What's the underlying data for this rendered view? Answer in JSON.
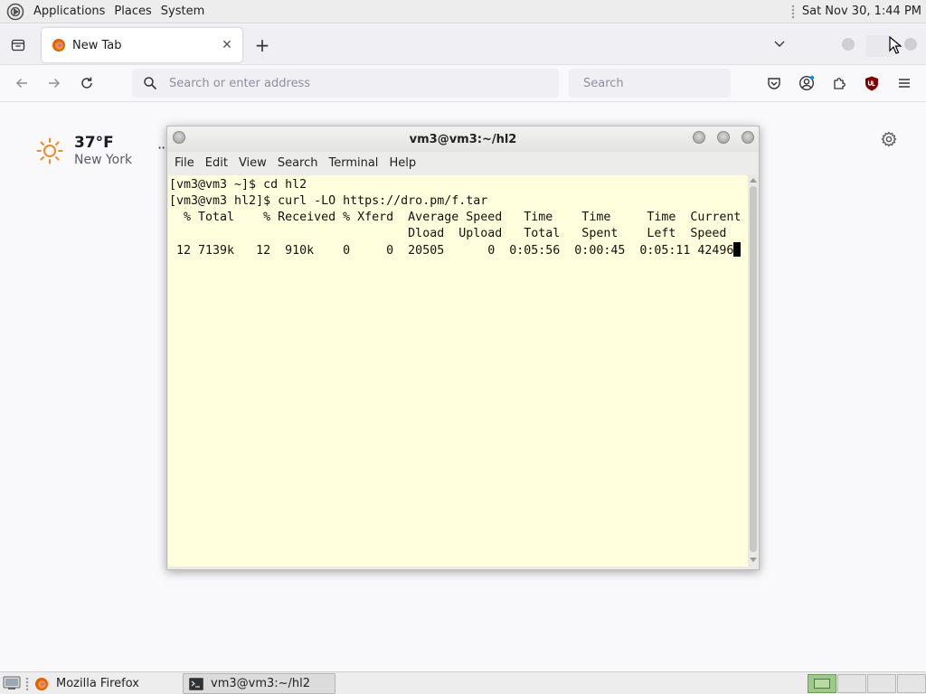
{
  "top_panel": {
    "menus": [
      "Applications",
      "Places",
      "System"
    ],
    "clock": "Sat Nov 30, 1:44 PM"
  },
  "browser": {
    "tab": {
      "title": "New Tab",
      "close_label": "✕"
    },
    "new_tab_label": "+",
    "url_placeholder": "Search or enter address",
    "search_placeholder": "Search"
  },
  "newtab": {
    "weather": {
      "temp": "37°F",
      "city": "New York",
      "more_label": "··"
    }
  },
  "terminal": {
    "title": "vm3@vm3:~/hl2",
    "menus": [
      "File",
      "Edit",
      "View",
      "Search",
      "Terminal",
      "Help"
    ],
    "lines": [
      "[vm3@vm3 ~]$ cd hl2",
      "[vm3@vm3 hl2]$ curl -LO https://dro.pm/f.tar",
      "  % Total    % Received % Xferd  Average Speed   Time    Time     Time  Current",
      "                                 Dload  Upload   Total   Spent    Left  Speed",
      " 12 7139k   12  910k    0     0  20505      0  0:05:56  0:00:45  0:05:11 42496"
    ]
  },
  "taskbar": {
    "items": [
      {
        "label": "Mozilla Firefox",
        "icon": "firefox-icon",
        "active": false
      },
      {
        "label": "vm3@vm3:~/hl2",
        "icon": "terminal-icon",
        "active": true
      }
    ],
    "workspaces": 4,
    "current_workspace": 1
  },
  "colors": {
    "terminal_background": "#ffffdd",
    "panel": "#ededed",
    "browser_chrome": "#f0f0f4"
  }
}
